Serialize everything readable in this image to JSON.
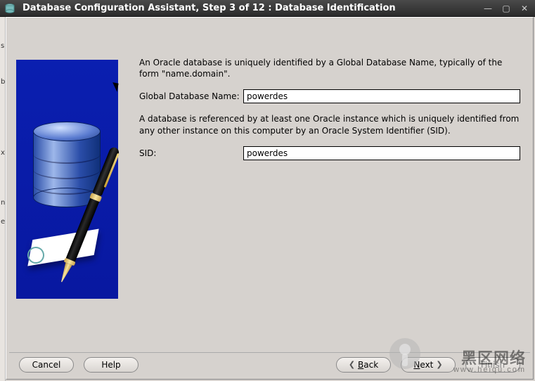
{
  "window": {
    "title": "Database Configuration Assistant, Step 3 of 12 : Database Identification"
  },
  "sidebar_letters": [
    "s",
    "b",
    "x",
    "n",
    "e"
  ],
  "intro1": "An Oracle database is uniquely identified by a Global Database Name, typically of the form \"name.domain\".",
  "intro2": "A database is referenced by at least one Oracle instance which is uniquely identified from any other instance on this computer by an Oracle System Identifier (SID).",
  "fields": {
    "gdn_label": "Global Database Name:",
    "gdn_value": "powerdes",
    "sid_label": "SID:",
    "sid_value": "powerdes"
  },
  "buttons": {
    "cancel": "Cancel",
    "help": "Help",
    "back_prefix": "B",
    "back_rest": "ack",
    "next_prefix": "N",
    "next_rest": "ext",
    "finish": "Finish"
  },
  "watermark": {
    "main": "黑区网络",
    "sub": "www.heiqu.com"
  }
}
